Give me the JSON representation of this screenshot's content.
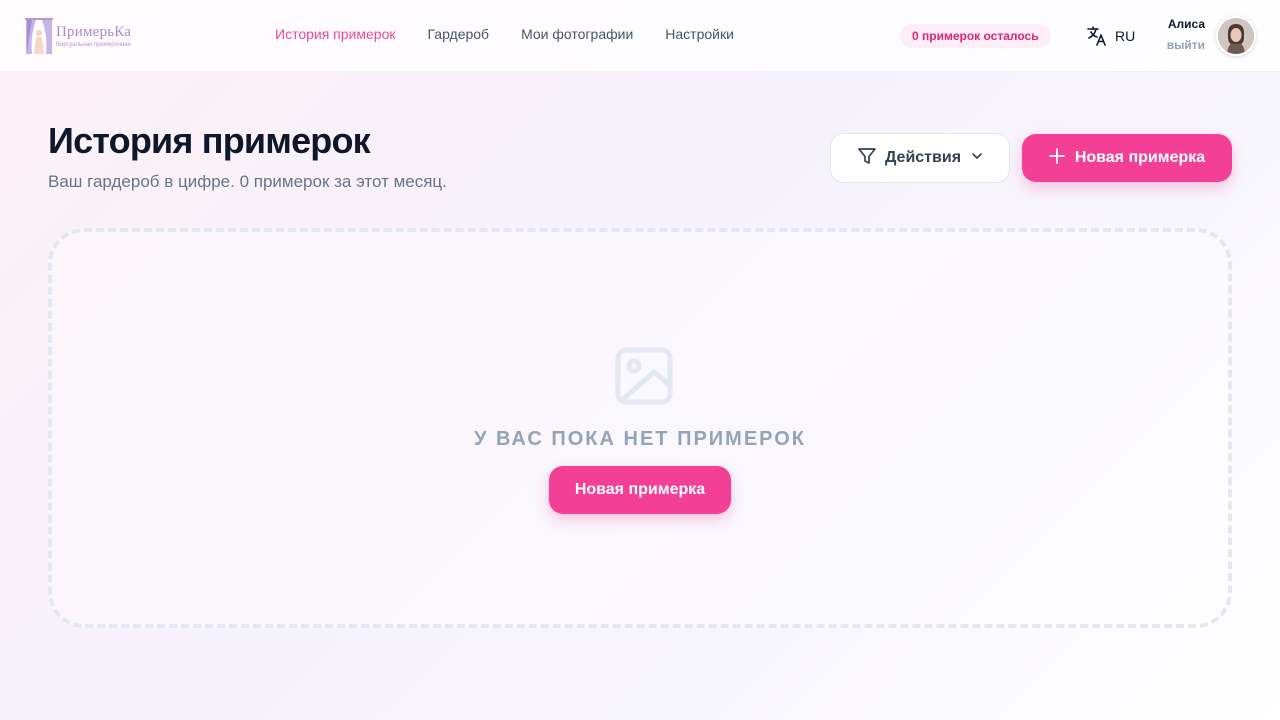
{
  "brand": {
    "title": "ПримерьКа",
    "subtitle": "Виртуальная примерочная"
  },
  "nav": {
    "items": [
      {
        "label": "История примерок",
        "active": true
      },
      {
        "label": "Гардероб",
        "active": false
      },
      {
        "label": "Мои фотографии",
        "active": false
      },
      {
        "label": "Настройки",
        "active": false
      }
    ]
  },
  "header": {
    "tryons_left": "0 примерок осталось",
    "language": "RU",
    "language_icon": "translate-icon",
    "user_name": "Алиса",
    "logout_label": "выйти"
  },
  "main": {
    "title": "История примерок",
    "subtitle": "Ваш гардероб в цифре. 0 примерок за этот месяц.",
    "actions_label": "Действия",
    "new_tryon_label": "Новая примерка"
  },
  "empty_state": {
    "icon": "image-placeholder-icon",
    "message": "У ВАС ПОКА НЕТ ПРИМЕРОК",
    "button_label": "Новая примерка"
  },
  "colors": {
    "accent": "#f43f96",
    "active_nav": "#ec4899",
    "badge_bg": "#fdeef5",
    "badge_text": "#db2777",
    "muted": "#94a3b8"
  }
}
